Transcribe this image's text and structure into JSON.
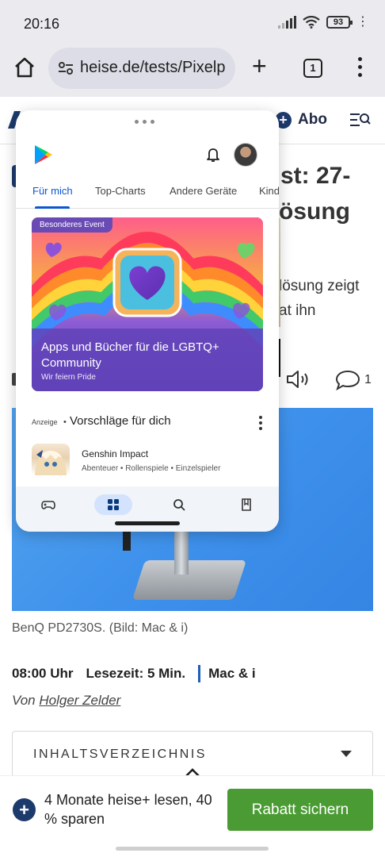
{
  "status_bar": {
    "time": "20:16",
    "battery": "93"
  },
  "browser": {
    "url": "heise.de/tests/Pixelp",
    "tab_count": "1"
  },
  "site": {
    "abo_label": "Abo",
    "title_line1_fragment": "st: 27-",
    "title_line2_fragment": "ösung",
    "lead_line1_fragment": "lösung zeigt",
    "lead_line2_fragment": "at ihn",
    "comment_count": "1",
    "caption": "BenQ PD2730S. (Bild: Mac & i)",
    "meta": {
      "time": "08:00 Uhr",
      "reading": "Lesezeit: 5 Min.",
      "section": "Mac & i"
    },
    "author_prefix": "Von",
    "author_name": "Holger Zelder",
    "toc_label": "INHALTSVERZEICHNIS"
  },
  "promo": {
    "text": "4 Monate heise+ lesen, 40 % sparen",
    "button": "Rabatt sichern"
  },
  "play_store": {
    "tabs": [
      "Für mich",
      "Top-Charts",
      "Andere Geräte",
      "Kind"
    ],
    "active_tab_index": 0,
    "event": {
      "badge": "Besonderes Event",
      "title": "Apps und Bücher für die LGBTQ+ Community",
      "subtitle": "Wir feiern Pride"
    },
    "suggestions": {
      "ad_label": "Anzeige",
      "dot": "•",
      "title": "Vorschläge für dich"
    },
    "app": {
      "name": "Genshin Impact",
      "tags": "Abenteuer • Rollenspiele • Einzelspieler"
    },
    "nav": [
      "games-icon",
      "apps-icon",
      "search-icon",
      "books-icon"
    ],
    "active_nav_index": 1
  },
  "colors": {
    "heise_blue": "#1d3a6d",
    "promo_green": "#4a9b33",
    "play_accent": "#0b57d0"
  }
}
